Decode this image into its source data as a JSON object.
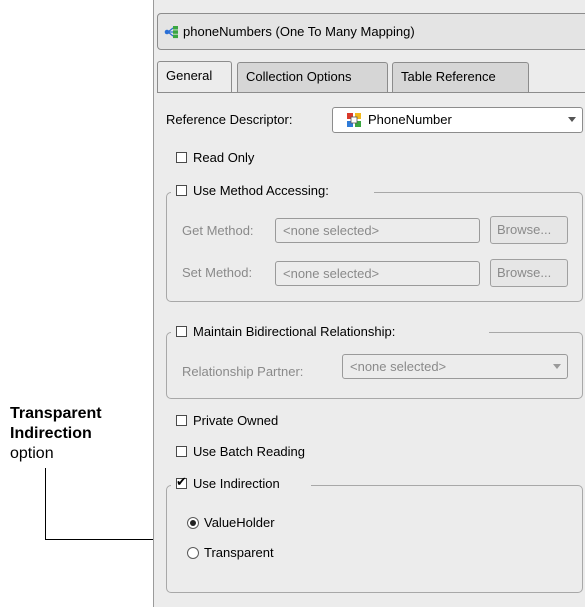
{
  "callout": {
    "line1": "Transparent",
    "line2": "Indirection",
    "line3": "option"
  },
  "header": {
    "icon": "one-to-many-mapping-icon",
    "title": "phoneNumbers (One To Many Mapping)"
  },
  "tabs": [
    {
      "label": "General",
      "active": true
    },
    {
      "label": "Collection Options",
      "active": false
    },
    {
      "label": "Table Reference",
      "active": false
    }
  ],
  "general": {
    "reference_descriptor_label": "Reference Descriptor:",
    "reference_descriptor_value": "PhoneNumber",
    "reference_descriptor_icon": "descriptor-icon",
    "read_only": {
      "label": "Read Only",
      "checked": false
    },
    "method_accessing": {
      "label": "Use Method Accessing:",
      "checked": false,
      "get_label": "Get Method:",
      "get_value": "<none selected>",
      "set_label": "Set Method:",
      "set_value": "<none selected>",
      "browse_label": "Browse..."
    },
    "bidirectional": {
      "label": "Maintain Bidirectional Relationship:",
      "checked": false,
      "partner_label": "Relationship Partner:",
      "partner_value": "<none selected>"
    },
    "private_owned": {
      "label": "Private Owned",
      "checked": false
    },
    "batch_reading": {
      "label": "Use Batch Reading",
      "checked": false
    },
    "indirection": {
      "label": "Use Indirection",
      "checked": true,
      "options": [
        {
          "label": "ValueHolder",
          "selected": true
        },
        {
          "label": "Transparent",
          "selected": false
        }
      ]
    }
  }
}
